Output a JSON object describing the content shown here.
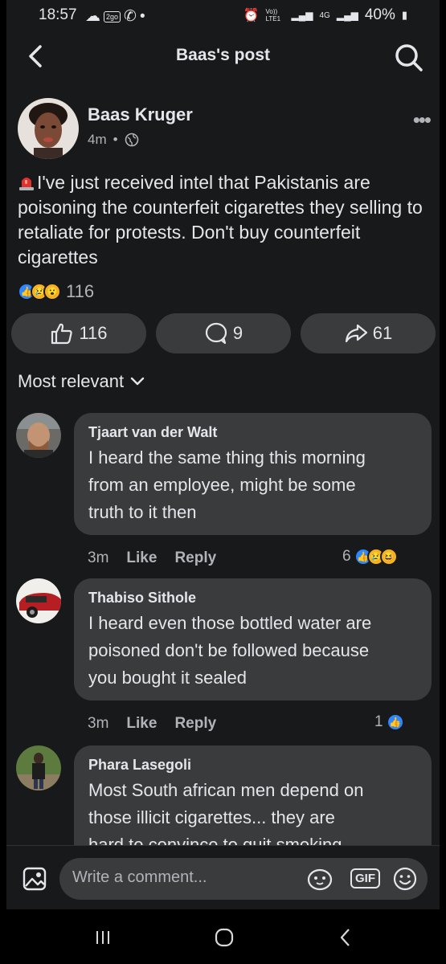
{
  "status_bar": {
    "time": "18:57",
    "badge": "2go",
    "battery": "40%",
    "net1": "Vo)) LTE1",
    "net2": "4G"
  },
  "header": {
    "title": "Baas's post"
  },
  "post": {
    "author": "Baas Kruger",
    "time": "4m",
    "text": "I've just received intel that Pakistanis are poisoning the counterfeit cigarettes they selling to retaliate for protests. Don't buy counterfeit cigarettes",
    "reaction_count": "116",
    "like_count": "116",
    "comment_count": "9",
    "share_count": "61"
  },
  "filter": {
    "label": "Most relevant"
  },
  "comments": [
    {
      "name": "Tjaart van der Walt",
      "lines": [
        "I heard the same thing this morning",
        "from an employee, might be some",
        "truth to it then"
      ],
      "time": "3m",
      "like": "Like",
      "reply": "Reply",
      "reactions": "6"
    },
    {
      "name": "Thabiso Sithole",
      "lines": [
        "I heard even those bottled water are",
        "poisoned don't be followed because",
        "you bought it sealed"
      ],
      "time": "3m",
      "like": "Like",
      "reply": "Reply",
      "reactions": "1"
    },
    {
      "name": "Phara Lasegoli",
      "lines": [
        "Most South african men depend on",
        "those illicit cigarettes... they are",
        "hard to convince to quit smoking"
      ]
    }
  ],
  "comment_bar": {
    "placeholder": "Write a comment...",
    "gif": "GIF"
  },
  "colors": {
    "bg": "#18191a",
    "surface": "#3a3b3c",
    "text": "#e4e6eb",
    "muted": "#b0b3b8",
    "like_blue": "#2d88ff"
  }
}
